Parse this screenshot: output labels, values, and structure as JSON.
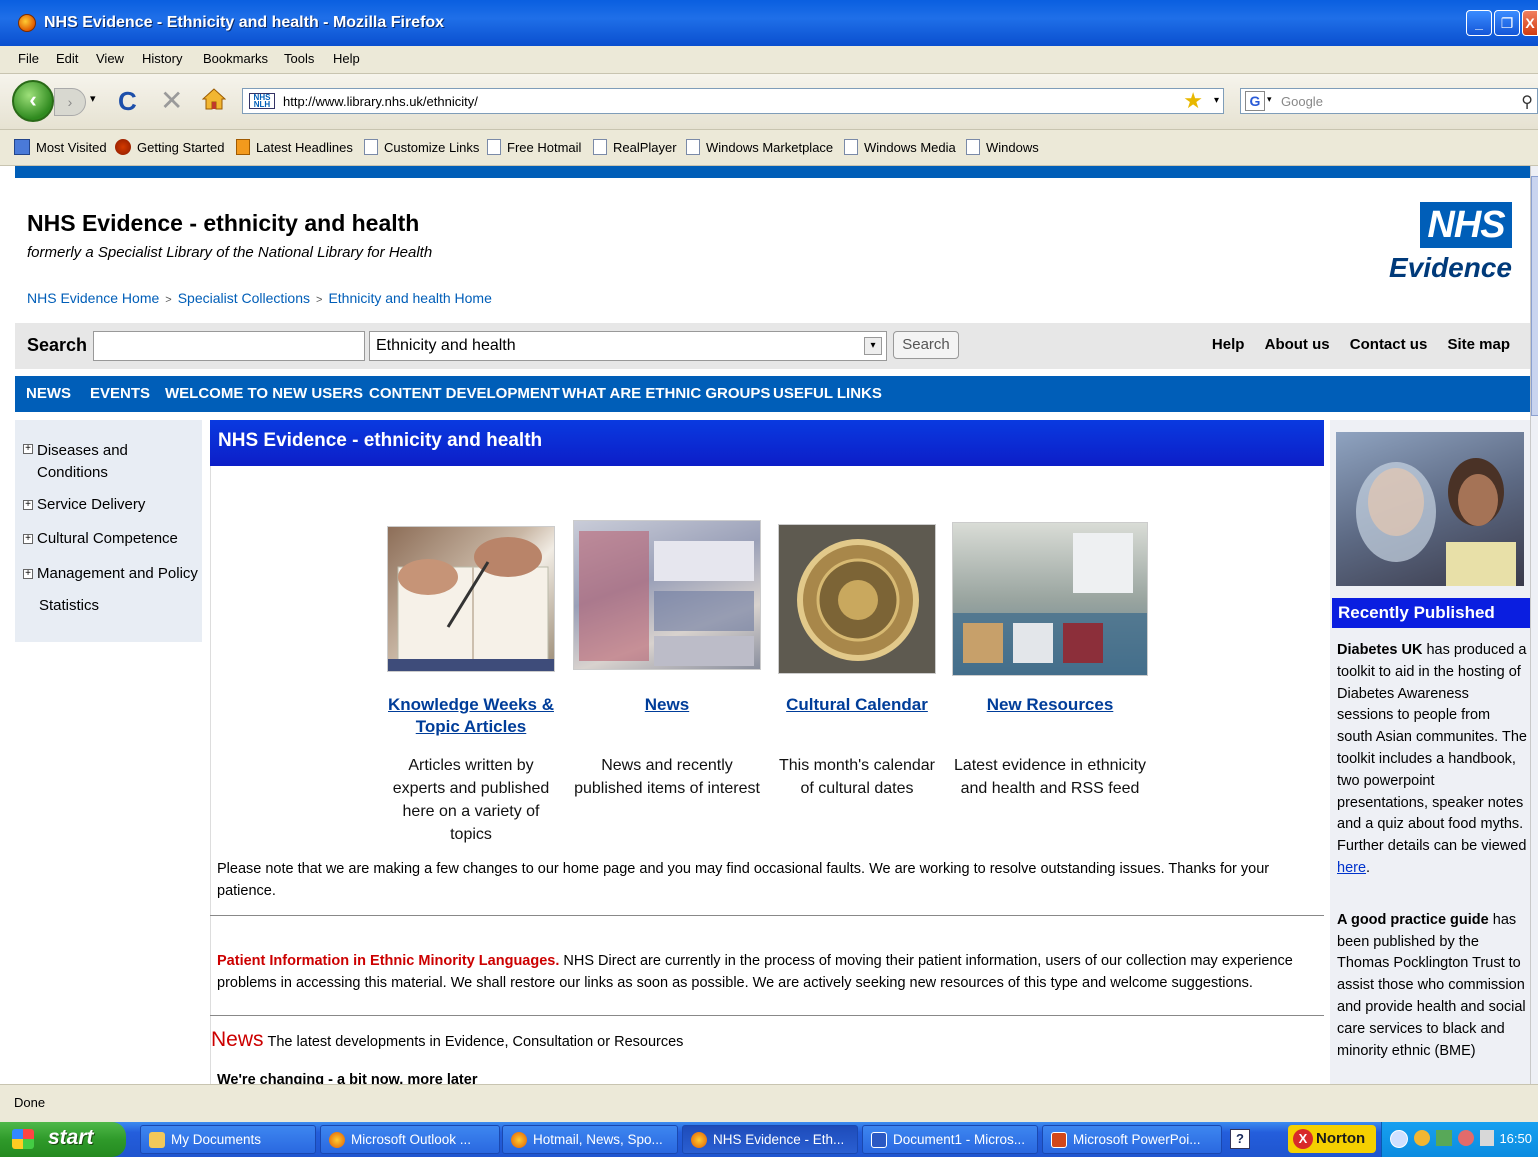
{
  "window": {
    "title": "NHS Evidence - Ethnicity and health - Mozilla Firefox",
    "minimize": "_",
    "maximize": "❐",
    "close": "X"
  },
  "menu": [
    "File",
    "Edit",
    "View",
    "History",
    "Bookmarks",
    "Tools",
    "Help"
  ],
  "navbar": {
    "back_glyph": "‹",
    "forward_glyph": "›",
    "dropdown_glyph": "▾",
    "reload_glyph": "C",
    "stop_glyph": "✕",
    "url": "http://www.library.nhs.uk/ethnicity/",
    "site_icon_text": "NHS NLH",
    "bookmark_star": "★",
    "url_dropdown": "▾",
    "search_engine_glyph": "G",
    "search_engine_arrow": "▾",
    "search_placeholder": "Google",
    "search_glyph": "⚲"
  },
  "bookmarks": [
    "Most Visited",
    "Getting Started",
    "Latest Headlines",
    "Customize Links",
    "Free Hotmail",
    "RealPlayer",
    "Windows Marketplace",
    "Windows Media",
    "Windows"
  ],
  "header": {
    "title": "NHS Evidence - ethnicity and health",
    "subtitle": "formerly a Specialist Library of the National Library for Health",
    "breadcrumb": [
      "NHS Evidence Home",
      "Specialist Collections",
      "Ethnicity and health Home"
    ],
    "breadcrumb_sep": ">",
    "logo_top": "NHS",
    "logo_bottom": "Evidence"
  },
  "search": {
    "label": "Search",
    "input_value": "",
    "select_value": "Ethnicity and health",
    "caret": "▾",
    "button": "Search",
    "links": [
      "Help",
      "About us",
      "Contact us",
      "Site map"
    ]
  },
  "mainnav": [
    "NEWS",
    "EVENTS",
    "WELCOME TO NEW USERS",
    "CONTENT DEVELOPMENT",
    "WHAT ARE ETHNIC GROUPS",
    "USEFUL LINKS"
  ],
  "leftnav": {
    "plus": "+",
    "items": [
      "Diseases and Conditions",
      "Service Delivery",
      "Cultural Competence",
      "Management and Policy",
      "Statistics"
    ]
  },
  "content": {
    "heading": "NHS Evidence - ethnicity and health",
    "features": [
      {
        "title": "Knowledge Weeks & Topic Articles",
        "desc": "Articles written by experts and published here on a variety of topics"
      },
      {
        "title": "News",
        "desc": "News and recently published items of interest"
      },
      {
        "title": "Cultural Calendar",
        "desc": "This month's calendar of cultural dates"
      },
      {
        "title": "New Resources",
        "desc": "Latest evidence in ethnicity and health and RSS feed"
      }
    ],
    "notice": "Please note that we are making a few changes to our home page and you may find occasional faults.  We are working to resolve outstanding issues.  Thanks for your patience.",
    "patient_title": "Patient Information in Ethnic Minority Languages.",
    "patient_text": " NHS Direct are currently in the process of moving their patient information, users of our collection may experience problems in accessing this material. We shall restore our links as soon as possible. We are actively seeking new resources of this type and welcome suggestions.",
    "news_label": "News",
    "news_text": "The latest developments in Evidence, Consultation or Resources",
    "changing": "We're changing - a bit now, more later"
  },
  "sidebar": {
    "heading": "Recently Published",
    "item1_bold": "Diabetes UK",
    "item1_text": " has produced a toolkit to aid in the hosting of Diabetes Awareness sessions to people from south Asian communites. The toolkit includes a handbook, two powerpoint presentations, speaker notes and a quiz about food myths. Further details can be viewed ",
    "item1_link": "here",
    "item1_end": ".",
    "item2_bold": "A good practice guide",
    "item2_text": " has been published by the Thomas Pocklington Trust to assist those who commission and provide health and social care services to black and minority ethnic (BME)"
  },
  "status": "Done",
  "taskbar": {
    "start": "start",
    "tasks": [
      "My Documents",
      "Microsoft Outlook ...",
      "Hotmail, News, Spo...",
      "NHS Evidence - Eth...",
      "Document1 - Micros...",
      "Microsoft PowerPoi..."
    ],
    "help_glyph": "?",
    "norton": "Norton",
    "norton_glyph": "X",
    "clock": "16:50"
  },
  "colors": {
    "nhs_blue": "#005EB8",
    "heading_blue": "#0a1ee0",
    "alert_red": "#cc0000"
  }
}
